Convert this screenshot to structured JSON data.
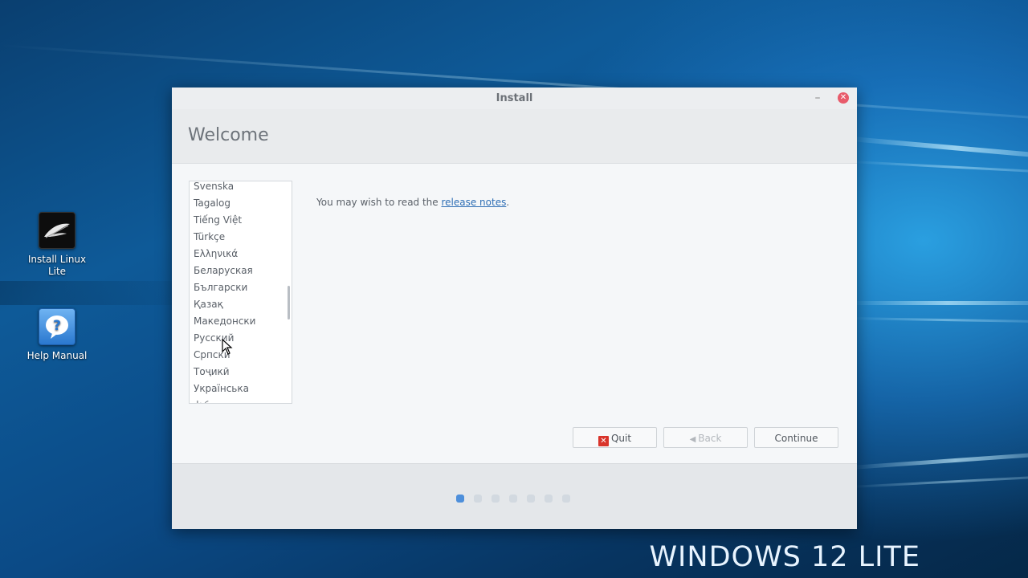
{
  "desktop": {
    "icons": [
      {
        "label": "Install Linux Lite",
        "icon": "feather-icon"
      },
      {
        "label": "Help Manual",
        "icon": "question-icon"
      }
    ],
    "watermark": "WINDOWS 12 LITE"
  },
  "window": {
    "title": "Install",
    "minimize_icon": "minimize-icon",
    "close_icon": "close-icon",
    "header": "Welcome",
    "languages": [
      "Svenska",
      "Tagalog",
      "Tiếng Việt",
      "Türkçe",
      "Ελληνικά",
      "Беларуская",
      "Български",
      "Қазақ",
      "Македонски",
      "Русский",
      "Српски",
      "Тоҷикӣ",
      "Українська",
      "ქართული"
    ],
    "release_text_before": "You may wish to read the ",
    "release_link": "release notes",
    "release_text_after": ".",
    "buttons": {
      "quit": "Quit",
      "back": "Back",
      "continue": "Continue"
    },
    "progress": {
      "total_steps": 7,
      "current_step": 1
    }
  },
  "colors": {
    "accent": "#4d8fdb",
    "close": "#e85b6b",
    "link": "#2f6fb5"
  }
}
